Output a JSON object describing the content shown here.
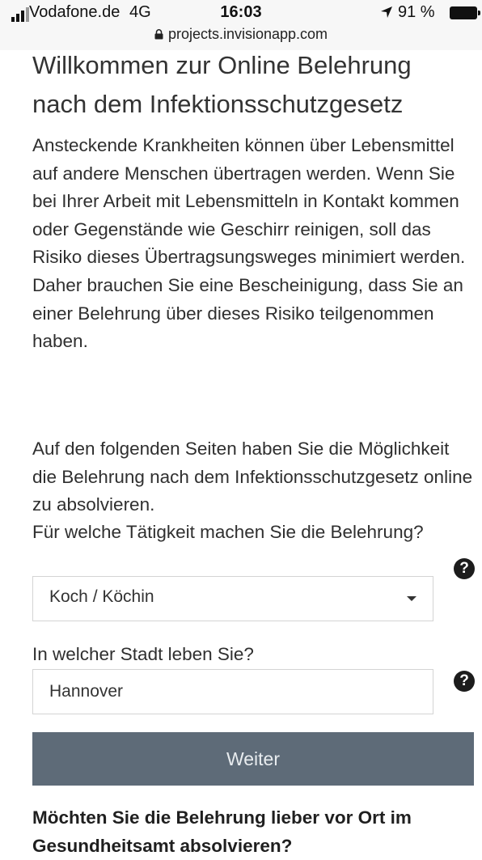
{
  "status_bar": {
    "carrier": "Vodafone.de",
    "network": "4G",
    "time": "16:03",
    "battery": "91 %",
    "url": "projects.invisionapp.com"
  },
  "page": {
    "title": "Willkommen zur Online Belehrung nach dem Infektionsschutzgesetz",
    "intro_paragraph": "Ansteckende Krankheiten können über Lebensmittel auf andere Menschen übertragen werden. Wenn Sie bei Ihrer Arbeit mit Lebensmitteln in Kontakt kommen oder Gegenstände wie Geschirr reinigen, soll das Risiko dieses Übertragsungsweges minimiert werden. Daher brauchen Sie eine Bescheinigung, dass Sie an einer Belehrung über dieses Risiko teilgenommen haben.",
    "next_pages_paragraph": "Auf den folgenden Seiten haben Sie die Möglichkeit die Belehrung nach dem Infektionsschutzgesetz online zu absolvieren."
  },
  "form": {
    "activity_label": "Für welche Tätigkeit machen Sie die Belehrung?",
    "activity_value": "Koch / Köchin",
    "city_label": "In welcher Stadt leben Sie?",
    "city_value": "Hannover",
    "help_symbol": "?",
    "submit_label": "Weiter"
  },
  "onsite_question": "Möchten Sie die Belehrung lieber vor Ort im Gesundheitsamt absolvieren?",
  "colors": {
    "button_bg": "#5e6b78",
    "button_text": "#e8ecef",
    "help_icon_bg": "#1c1c1c"
  },
  "icons": [
    "signal-icon",
    "location-arrow-icon",
    "battery-icon",
    "lock-icon",
    "help-icon",
    "caret-down-icon"
  ]
}
